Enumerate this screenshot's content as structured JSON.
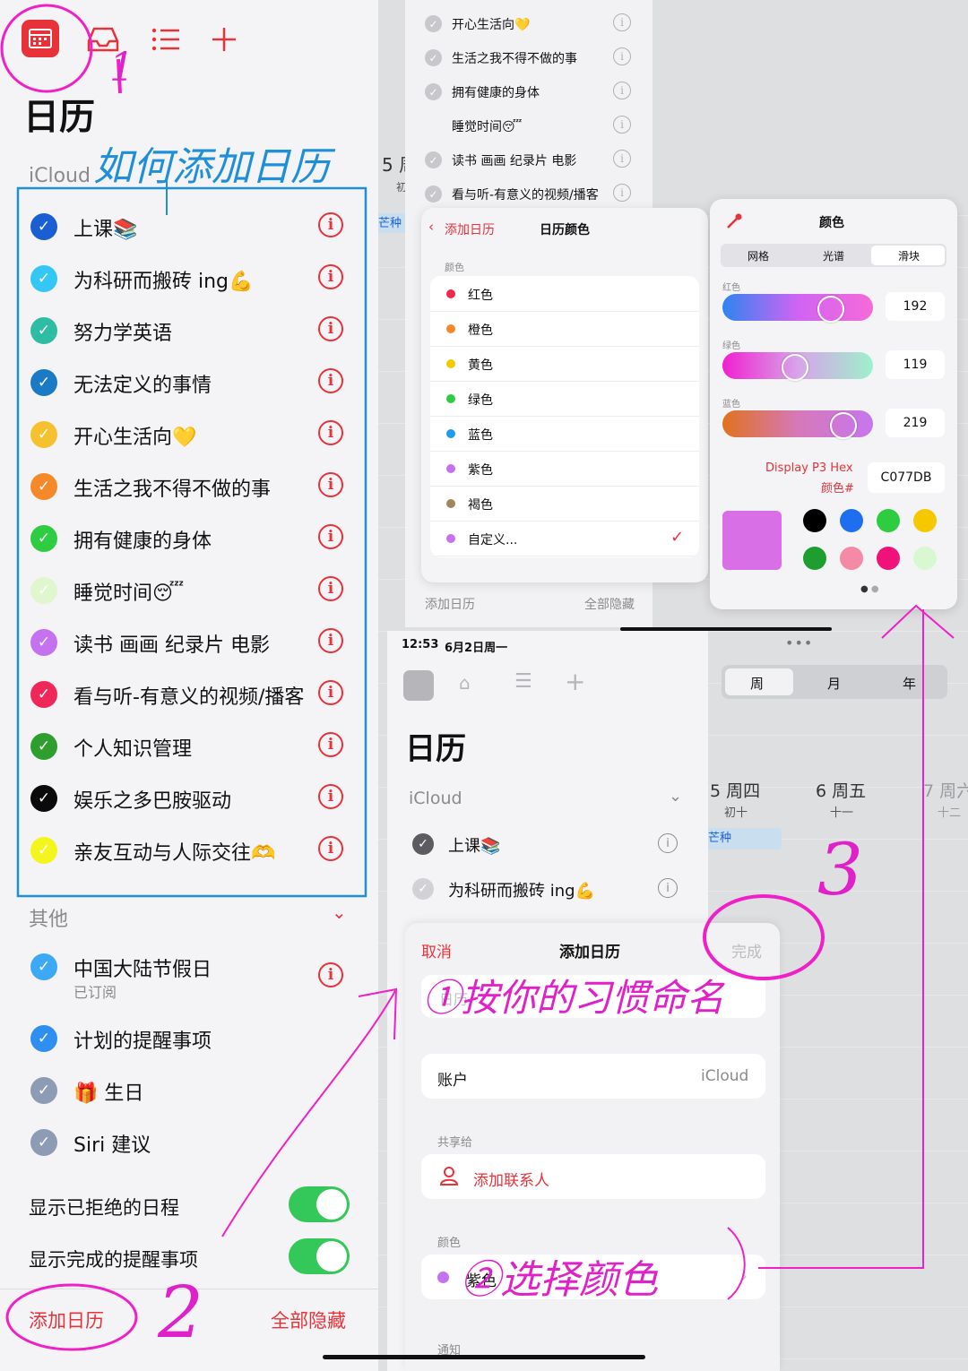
{
  "left": {
    "title": "日历",
    "icloud": "iCloud",
    "calendars": [
      {
        "label": "上课📚",
        "color": "#1a5fd1"
      },
      {
        "label": "为科研而搬砖 ing💪",
        "color": "#34c6f4"
      },
      {
        "label": "努力学英语",
        "color": "#2ebda3"
      },
      {
        "label": "无法定义的事情",
        "color": "#1a7bc4"
      },
      {
        "label": "开心生活向💛",
        "color": "#f6c12e"
      },
      {
        "label": "生活之我不得不做的事",
        "color": "#f5892a"
      },
      {
        "label": "拥有健康的身体",
        "color": "#2ecc40"
      },
      {
        "label": "睡觉时间😴",
        "color": "#dff6cf"
      },
      {
        "label": "读书 画画 纪录片 电影",
        "color": "#c572f0"
      },
      {
        "label": "看与听-有意义的视频/播客",
        "color": "#f0285a"
      },
      {
        "label": "个人知识管理",
        "color": "#2e9e2e"
      },
      {
        "label": "娱乐之多巴胺驱动",
        "color": "#0a0a0a"
      },
      {
        "label": "亲友互动与人际交往🫶",
        "color": "#f5f51e"
      }
    ],
    "other_header": "其他",
    "other": [
      {
        "label": "中国大陆节假日",
        "sub": "已订阅",
        "color": "#3da9f5",
        "info": true
      },
      {
        "label": "计划的提醒事项",
        "color": "#2f8ff0",
        "info": false
      },
      {
        "label": "🎁 生日",
        "color": "#8e9bb4",
        "info": false
      },
      {
        "label": "Siri 建议",
        "color": "#8e9bb4",
        "info": false
      }
    ],
    "toggle_declined": "显示已拒绝的日程",
    "toggle_completed": "显示完成的提醒事项",
    "add_calendar": "添加日历",
    "hide_all": "全部隐藏"
  },
  "top_list": {
    "items": [
      "开心生活向💛",
      "生活之我不得不做的事",
      "拥有健康的身体",
      "睡觉时间😴",
      "读书 画画 纪录片 电影",
      "看与听-有意义的视频/播客"
    ],
    "add_calendar": "添加日历",
    "hide_all": "全部隐藏"
  },
  "color_picker_list": {
    "back": "添加日历",
    "title": "日历颜色",
    "section": "颜色",
    "colors": [
      {
        "label": "红色",
        "color": "#f0284a"
      },
      {
        "label": "橙色",
        "color": "#f5892a"
      },
      {
        "label": "黄色",
        "color": "#f6c800"
      },
      {
        "label": "绿色",
        "color": "#2ecc40"
      },
      {
        "label": "蓝色",
        "color": "#1e9cf0"
      },
      {
        "label": "紫色",
        "color": "#c572f0"
      },
      {
        "label": "褐色",
        "color": "#a2845e"
      },
      {
        "label": "自定义...",
        "color": "#c572f0"
      }
    ],
    "checkmark": "✓"
  },
  "color_panel": {
    "title": "颜色",
    "tabs": [
      "网格",
      "光谱",
      "滑块"
    ],
    "red_label": "红色",
    "red_value": "192",
    "green_label": "绿色",
    "green_value": "119",
    "blue_label": "蓝色",
    "blue_value": "219",
    "hex_label_1": "Display P3 Hex",
    "hex_label_2": "颜色#",
    "hex_value": "C077DB",
    "swatches": [
      "#000000",
      "#1e6ff0",
      "#2ecc40",
      "#f6c800",
      "#1e9e2e",
      "#f58aa6",
      "#f0127a",
      "#d9f7d0"
    ],
    "preview_color": "#d96fe6"
  },
  "bottom_window": {
    "time": "12:53",
    "date": "6月2日周一",
    "title": "日历",
    "icloud": "iCloud",
    "items": [
      "上课📚",
      "为科研而搬砖 ing💪"
    ]
  },
  "calendar_bg": {
    "views": [
      "周",
      "月",
      "年"
    ],
    "days": [
      {
        "day": "5 周四",
        "lunar": "初十"
      },
      {
        "day": "6 周五",
        "lunar": "十一"
      },
      {
        "day": "7 周六",
        "lunar": "十二"
      }
    ],
    "event": "芒种",
    "partial_day": "5 周",
    "partial_lunar": "初"
  },
  "add_sheet": {
    "cancel": "取消",
    "title": "添加日历",
    "done": "完成",
    "name_placeholder": "日历",
    "account_label": "账户",
    "account_value": "iCloud",
    "share_header": "共享给",
    "add_contact": "添加联系人",
    "color_header": "颜色",
    "color_value": "紫色",
    "color_dot": "#c572f0",
    "notify_header": "通知"
  },
  "annotations": {
    "how_to": "如何添加日历",
    "one": "1",
    "two": "2",
    "three": "3",
    "name_hint": "①按你的习惯命名",
    "color_hint": "②选择颜色"
  }
}
